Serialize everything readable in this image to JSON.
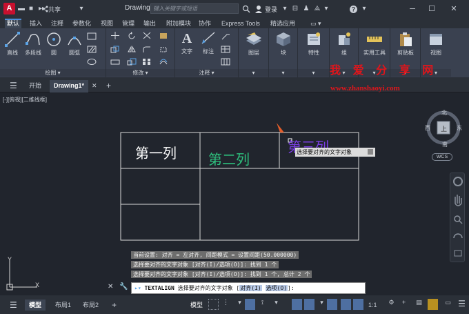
{
  "app": {
    "icon_letter": "A",
    "share_label": "共享",
    "doc_title": "Drawing1.dwg"
  },
  "search": {
    "placeholder": "键入关键字或短语"
  },
  "user": {
    "login_label": "登录"
  },
  "ribbon_tabs": [
    "默认",
    "插入",
    "注释",
    "参数化",
    "视图",
    "管理",
    "输出",
    "附加模块",
    "协作",
    "Express Tools",
    "精选应用"
  ],
  "active_ribbon_tab": "默认",
  "panels": {
    "draw": {
      "label": "绘图",
      "tools": [
        "直线",
        "多段线",
        "圆",
        "圆弧"
      ]
    },
    "modify": {
      "label": "修改"
    },
    "annotation": {
      "label": "注释",
      "tools": [
        "文字",
        "标注"
      ]
    },
    "layers": {
      "label": "图层"
    },
    "block": {
      "label": "块"
    },
    "properties": {
      "label": "特性"
    },
    "groups": {
      "label": "组"
    },
    "utilities": {
      "label": "实用工具"
    },
    "clipboard": {
      "label": "剪贴板"
    },
    "view": {
      "label": "视图"
    }
  },
  "watermark": {
    "line1": "我 爱 分 享 网",
    "line2": "www.zhanshaoyi.com"
  },
  "file_tabs": {
    "start": "开始",
    "drawing": "Drawing1*",
    "add": "+"
  },
  "viewport": {
    "label": "[-][俯视][二维线框]"
  },
  "table": {
    "cells": [
      "第一列",
      "第二列",
      "第三列"
    ],
    "colors": [
      "#ffffff",
      "#2ec27e",
      "#7b3fe4"
    ]
  },
  "tooltip": {
    "text": "选择要对齐的文字对象"
  },
  "viewcube": {
    "north": "北",
    "south": "南",
    "east": "东",
    "west": "西",
    "top": "上",
    "wcs": "WCS"
  },
  "ucs": {
    "x": "X",
    "y": "Y"
  },
  "command_history": [
    "当前设置: 对齐 = 左对齐, 间距模式 = 设置间距(50.000000)",
    "选择要对齐的文字对象 [对齐(I)/选项(O)]: 找到 1 个",
    "选择要对齐的文字对象 [对齐(I)/选项(O)]: 找到 1 个, 总计 2 个"
  ],
  "command_line": {
    "cmd": "TEXTALIGN",
    "prompt": " 选择要对齐的文字对象 [",
    "opt1": "对齐(I)",
    "opt2": "选项(O)",
    "end": "]:"
  },
  "status": {
    "tabs": [
      "模型",
      "布局1",
      "布局2"
    ],
    "model_label": "模型",
    "scale": "1:1"
  }
}
